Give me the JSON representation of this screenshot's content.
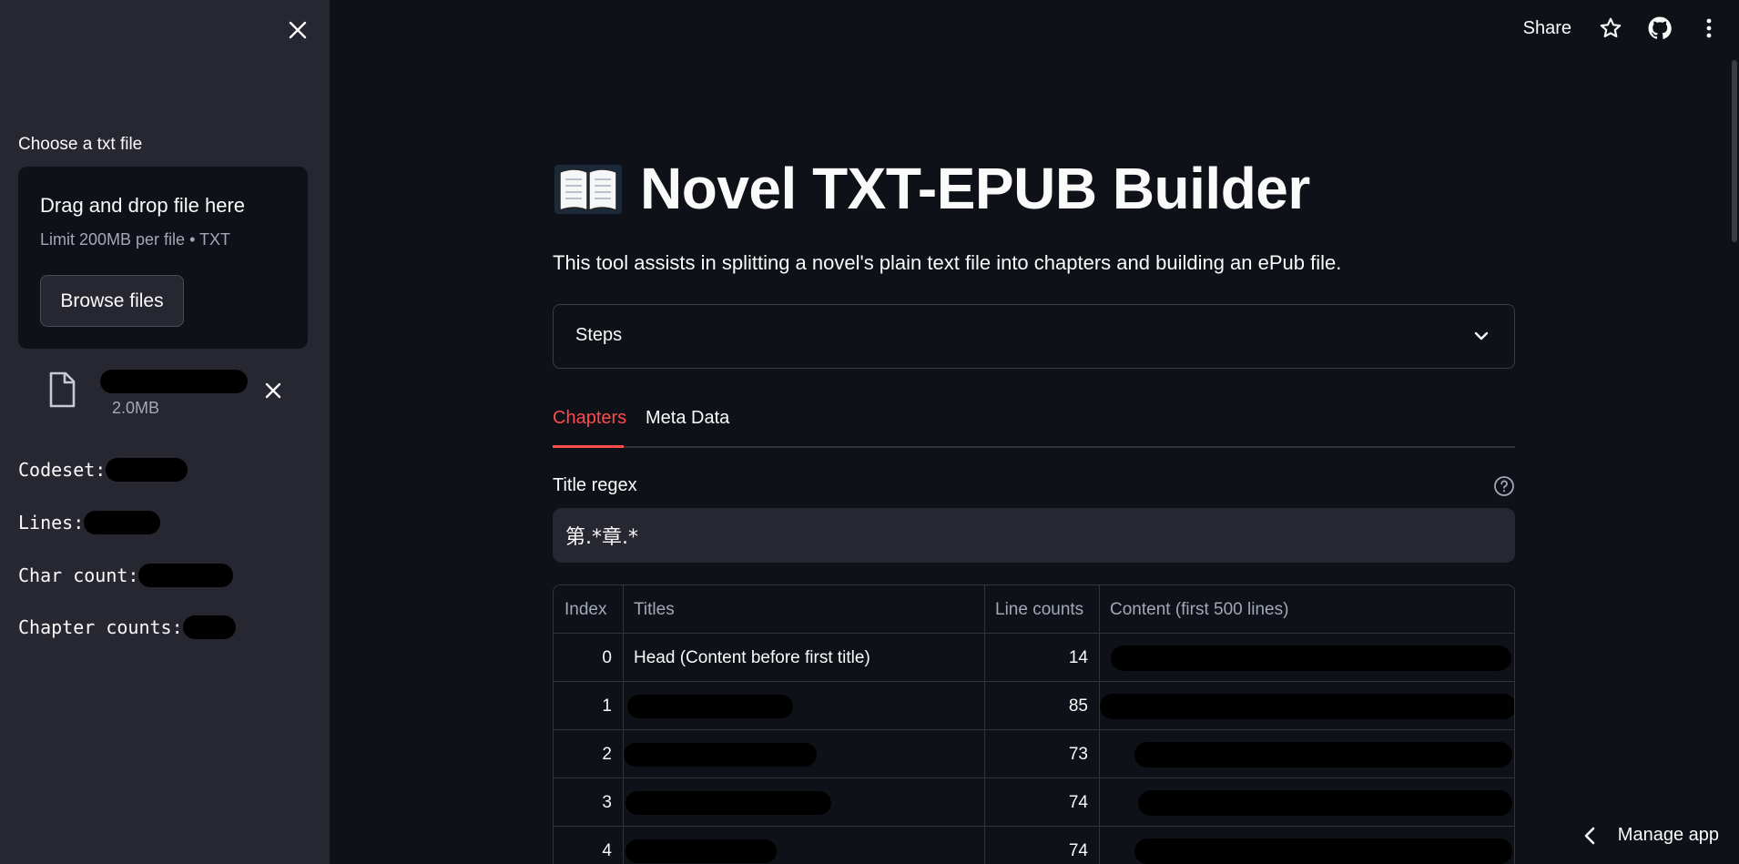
{
  "sidebar": {
    "close_icon": "close-icon",
    "upload": {
      "label": "Choose a txt file",
      "drop_title": "Drag and drop file here",
      "drop_limit": "Limit 200MB per file • TXT",
      "browse_label": "Browse files"
    },
    "file": {
      "icon": "file-icon",
      "size": "2.0MB",
      "remove_icon": "close-icon"
    },
    "stats": {
      "codeset_label": "Codeset:",
      "lines_label": "Lines:",
      "char_count_label": "Char count:",
      "chapter_counts_label": "Chapter counts:"
    }
  },
  "header": {
    "share_label": "Share",
    "icons": [
      "star-icon",
      "github-icon",
      "more-vertical-icon"
    ]
  },
  "main": {
    "title": "Novel TXT-EPUB Builder",
    "title_emoji": "book-icon",
    "subtitle": "This tool assists in splitting a novel's plain text file into chapters and building an ePub file.",
    "expander_label": "Steps",
    "tabs": [
      {
        "label": "Chapters",
        "active": true
      },
      {
        "label": "Meta Data",
        "active": false
      }
    ],
    "regex": {
      "label": "Title regex",
      "value": "第.*章.*"
    },
    "table": {
      "columns": [
        "Index",
        "Titles",
        "Line counts",
        "Content (first 500 lines)"
      ],
      "rows": [
        {
          "index": "0",
          "title": "Head (Content before first title)",
          "lines": "14"
        },
        {
          "index": "1",
          "title": "",
          "lines": "85"
        },
        {
          "index": "2",
          "title": "",
          "lines": "73"
        },
        {
          "index": "3",
          "title": "",
          "lines": "74"
        },
        {
          "index": "4",
          "title": "",
          "lines": "74"
        }
      ]
    }
  },
  "footer": {
    "manage_app_label": "Manage app"
  },
  "colors": {
    "background": "#0e1117",
    "sidebar": "#262730",
    "accent": "#ff4b4b",
    "text": "#fafafa",
    "muted": "#a3a8b8"
  }
}
